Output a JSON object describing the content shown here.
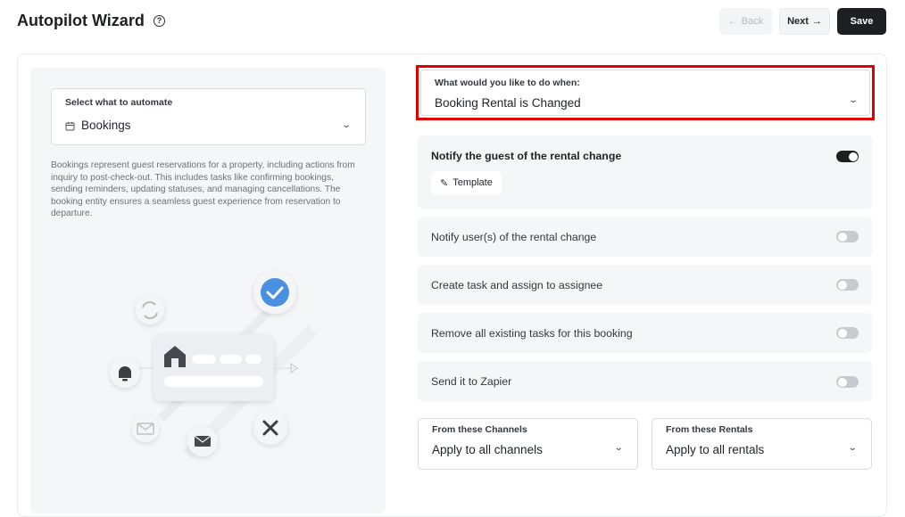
{
  "header": {
    "title": "Autopilot Wizard",
    "help_glyph": "?",
    "back_label": "Back",
    "next_label": "Next",
    "save_label": "Save"
  },
  "left": {
    "select_label": "Select what to automate",
    "select_value": "Bookings",
    "description": "Bookings represent guest reservations for a property, including actions from inquiry to post-check-out. This includes tasks like confirming bookings, sending reminders, updating statuses, and managing cancellations. The booking entity ensures a seamless guest experience from reservation to departure."
  },
  "trigger": {
    "label": "What would you like to do when:",
    "value": "Booking Rental is Changed"
  },
  "actions": [
    {
      "label": "Notify the guest of the rental change",
      "enabled": true,
      "button": "Template"
    },
    {
      "label": "Notify user(s) of the rental change",
      "enabled": false
    },
    {
      "label": "Create task and assign to assignee",
      "enabled": false
    },
    {
      "label": "Remove all existing tasks for this booking",
      "enabled": false
    },
    {
      "label": "Send it to Zapier",
      "enabled": false
    }
  ],
  "filters": {
    "channels_label": "From these Channels",
    "channels_value": "Apply to all channels",
    "rentals_label": "From these Rentals",
    "rentals_value": "Apply to all rentals"
  },
  "colors": {
    "highlight": "#e00000",
    "accent_blue": "#4a90e2",
    "dark": "#1d1f23"
  }
}
